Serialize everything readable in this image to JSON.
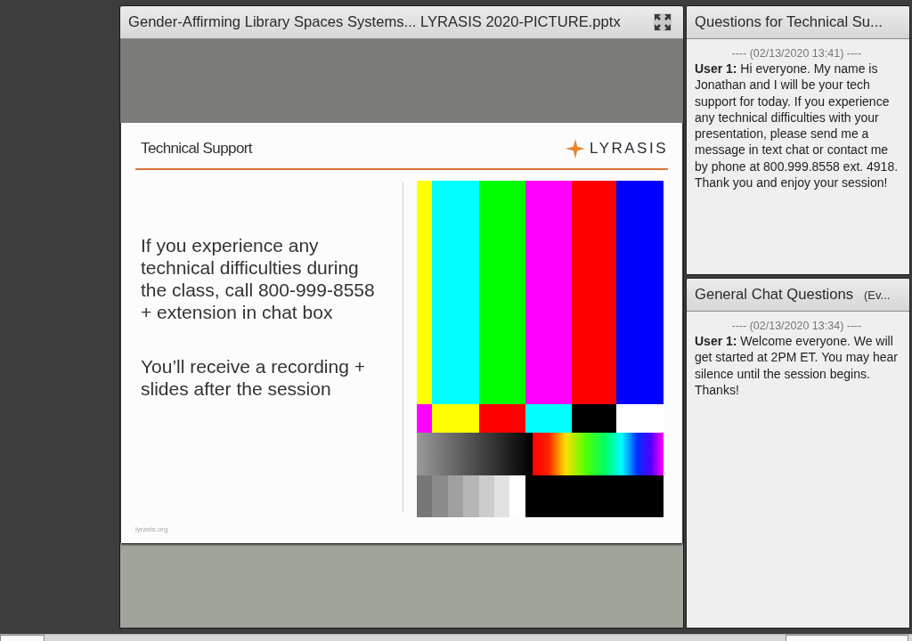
{
  "presentation_pod": {
    "title": "Gender-Affirming Library Spaces Systems... LYRASIS 2020-PICTURE.pptx"
  },
  "slide": {
    "title": "Technical Support",
    "logo_text": "LYRASIS",
    "paragraphs": [
      "If you experience any technical difficulties during the class, call 800-999-8558 + extension in chat box",
      "You’ll receive a recording + slides after the session"
    ],
    "footer": "lyrasis.org"
  },
  "chat_pods": [
    {
      "title": "Questions for Technical Su...",
      "messages": [
        {
          "timestamp": "---- (02/13/2020 13:41) ----",
          "text": "**User 1:** Hi everyone. My name is Jonathan and I will be your tech support for today. If you experience any technical difficulties with your presentation, please send me a message in text chat or contact me by phone at 800.999.8558 ext. 4918. Thank you and enjoy your session!"
        }
      ]
    },
    {
      "title": "General Chat Questions",
      "subtitle": "(Ev...",
      "messages": [
        {
          "timestamp": "---- (02/13/2020 13:34) ----",
          "text": "**User 1:** Welcome everyone. We will get started at 2PM ET. You may hear silence until the session begins. Thanks!"
        }
      ]
    }
  ]
}
